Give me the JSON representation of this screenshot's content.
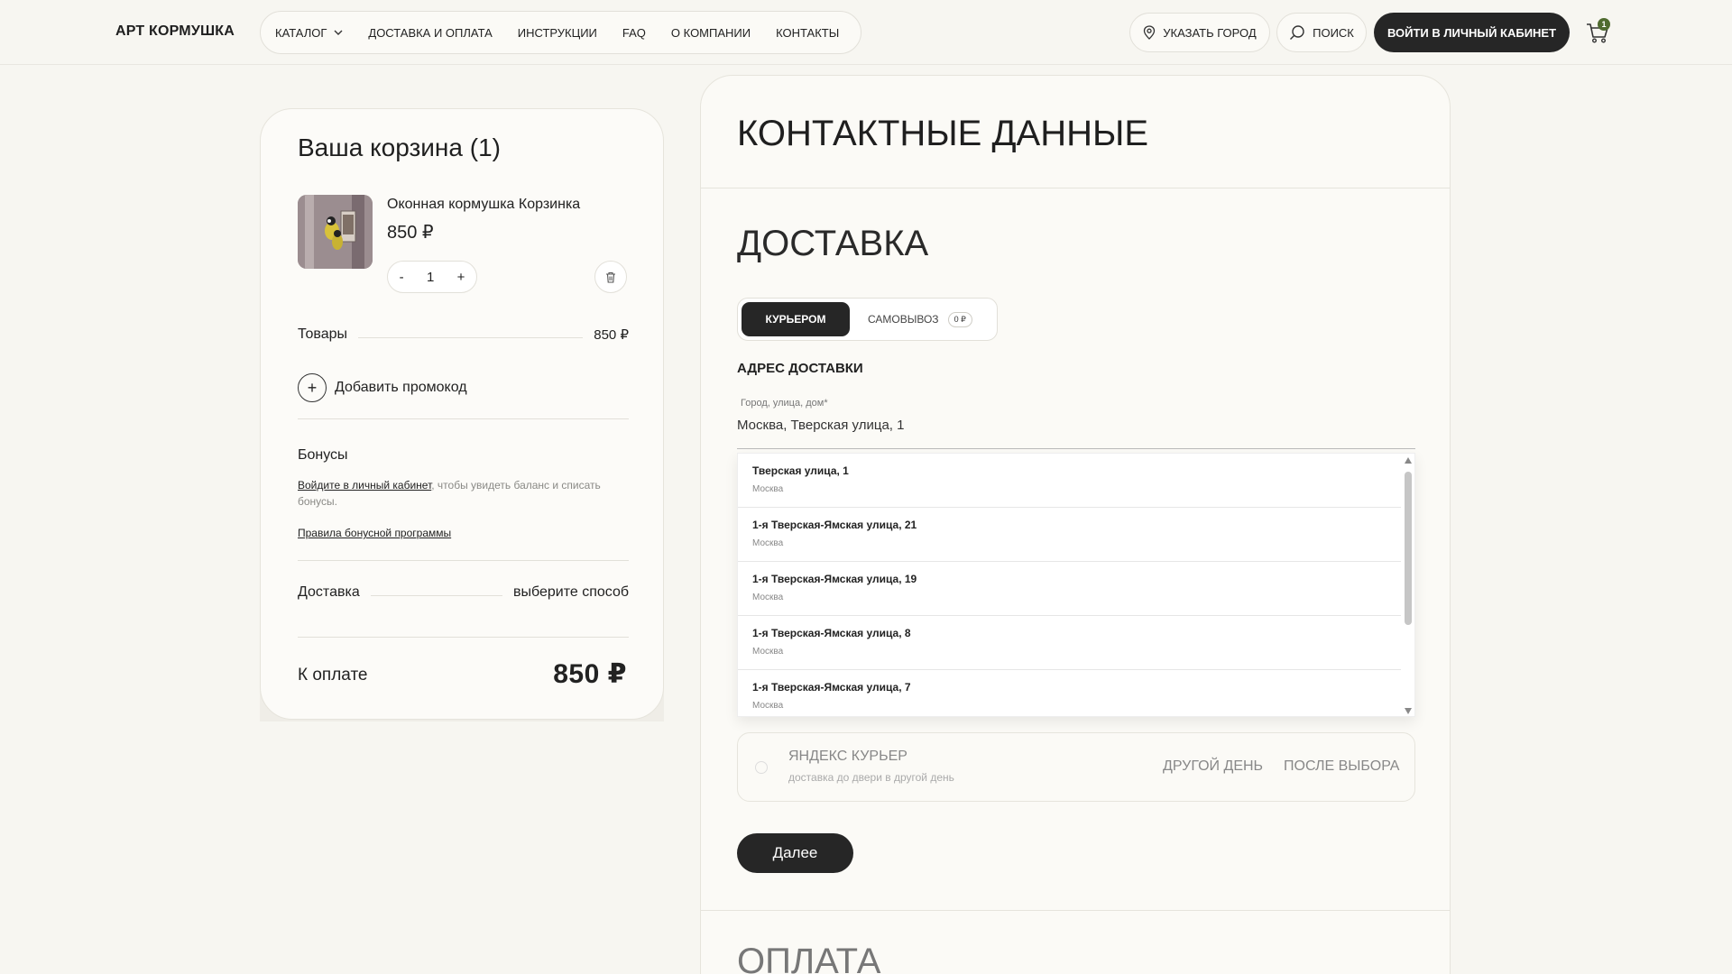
{
  "header": {
    "logo": "АРТ КОРМУШКА",
    "nav": [
      {
        "label": "КАТАЛОГ",
        "has_dropdown": true
      },
      {
        "label": "ДОСТАВКА И ОПЛАТА"
      },
      {
        "label": "ИНСТРУКЦИИ"
      },
      {
        "label": "FAQ"
      },
      {
        "label": "О КОМПАНИИ"
      },
      {
        "label": "КОНТАКТЫ"
      }
    ],
    "city_button": "УКАЗАТЬ ГОРОД",
    "search_button": "ПОИСК",
    "login_button": "ВОЙТИ В ЛИЧНЫЙ КАБИНЕТ",
    "cart_count": "1"
  },
  "cart": {
    "title": "Ваша корзина (1)",
    "item": {
      "name": "Оконная кормушка Корзинка",
      "price": "850 ₽",
      "qty_minus": "-",
      "qty": "1",
      "qty_plus": "+"
    },
    "goods_label": "Товары",
    "goods_value": "850 ₽",
    "promo_label": "Добавить промокод",
    "bonus_title": "Бонусы",
    "bonus_link": "Войдите в личный кабинет",
    "bonus_text": ", чтобы увидеть баланс и списать бонусы.",
    "bonus_rules": "Правила бонусной программы",
    "delivery_label": "Доставка",
    "delivery_value": "выберите способ",
    "pay_label": "К оплате",
    "pay_value": "850 ₽"
  },
  "checkout": {
    "contacts_title": "КОНТАКТНЫЕ ДАННЫЕ",
    "delivery_title": "ДОСТАВКА",
    "tabs": {
      "courier": "КУРЬЕРОМ",
      "pickup": "САМОВЫВОЗ",
      "pickup_price": "0 ₽"
    },
    "address_title": "АДРЕС ДОСТАВКИ",
    "address_label": "Город, улица, дом*",
    "address_value": "Москва, Тверская улица, 1",
    "suggestions": [
      {
        "title": "Тверская улица, 1",
        "city": "Москва"
      },
      {
        "title": "1-я Тверская-Ямская улица, 21",
        "city": "Москва"
      },
      {
        "title": "1-я Тверская-Ямская улица, 19",
        "city": "Москва"
      },
      {
        "title": "1-я Тверская-Ямская улица, 8",
        "city": "Москва"
      },
      {
        "title": "1-я Тверская-Ямская улица, 7",
        "city": "Москва"
      }
    ],
    "courier_option": {
      "name": "ЯНДЕКС КУРЬЕР",
      "desc": "доставка до двери в другой день",
      "when": "ДРУГОЙ ДЕНЬ",
      "price": "ПОСЛЕ ВЫБОРА"
    },
    "next_button": "Далее",
    "payment_title": "ОПЛАТА"
  }
}
